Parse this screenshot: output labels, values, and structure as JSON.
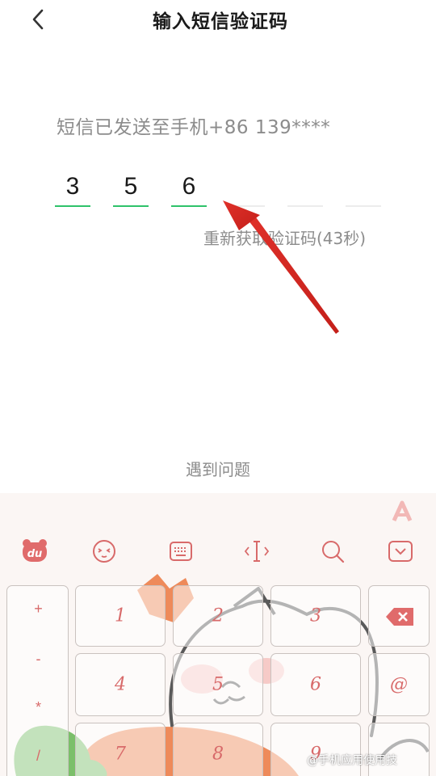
{
  "header": {
    "title": "输入短信验证码",
    "back_icon": "chevron-left-icon"
  },
  "verification": {
    "sent_hint": "短信已发送至手机+86 139****",
    "code_digits": [
      "3",
      "5",
      "6",
      "",
      "",
      ""
    ],
    "resend_text": "重新获取验证码(43秒)",
    "accent_color": "#2fc26a"
  },
  "help": {
    "problem_link": "遇到问题"
  },
  "annotation": {
    "arrow_color": "#e0312a"
  },
  "keyboard": {
    "toolbar_icons": [
      "du-bear-logo-icon",
      "emoji-face-icon",
      "keyboard-icon",
      "cursor-move-icon",
      "search-icon",
      "collapse-keyboard-icon"
    ],
    "top_right_icon": "text-a-icon",
    "symbols": [
      "+",
      "-",
      "*",
      "/"
    ],
    "keys": [
      "1",
      "2",
      "3",
      "4",
      "5",
      "6",
      "7",
      "8",
      "9"
    ],
    "delete_key_icon": "backspace-icon",
    "at_key": "@",
    "key_color": "#d86a6a"
  },
  "watermark": {
    "text": "@手机应用使用技"
  }
}
